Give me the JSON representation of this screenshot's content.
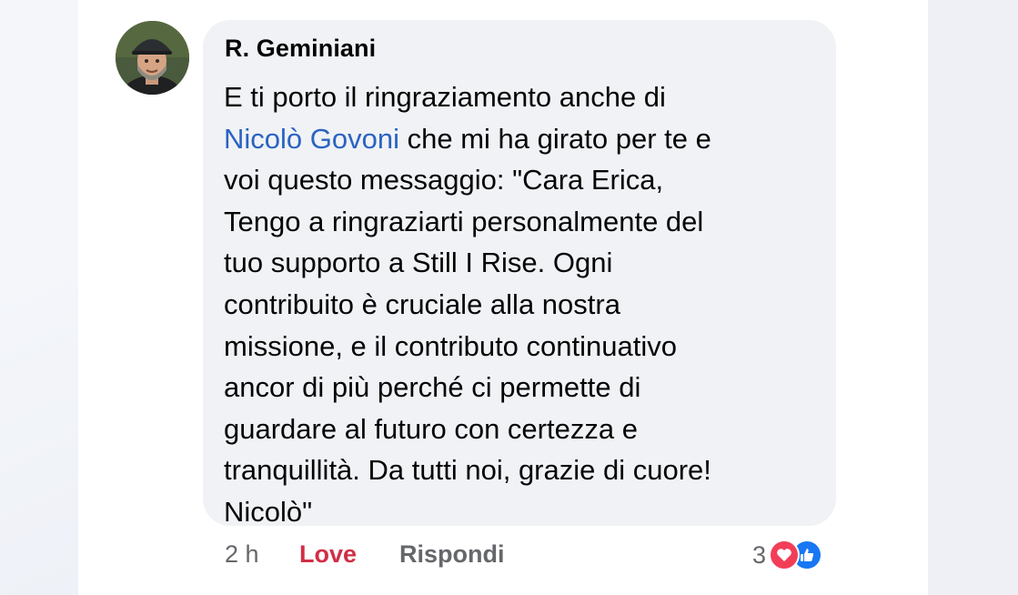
{
  "comment": {
    "author": "R. Geminiani",
    "avatar_icon": "profile-photo-man-with-cap",
    "message_lines": [
      {
        "text": "E ti porto il ringraziamento anche di"
      },
      {
        "mention": "Nicolò Govoni",
        "text": " che mi ha girato per te e"
      },
      {
        "text": "voi questo messaggio: \"Cara Erica,"
      },
      {
        "text": "Tengo a ringraziarti personalmente del"
      },
      {
        "text": "tuo supporto a Still I Rise. Ogni"
      },
      {
        "text": "contribuito è cruciale alla nostra"
      },
      {
        "text": "missione, e il contributo continuativo"
      },
      {
        "text": "ancor di più perché ci permette di"
      },
      {
        "text": "guardare al futuro con certezza e"
      },
      {
        "text": "tranquillità. Da tutti noi, grazie di cuore!"
      },
      {
        "text": "Nicolò\""
      }
    ]
  },
  "footer": {
    "time": "2 h",
    "love_label": "Love",
    "reply_label": "Rispondi",
    "reaction_count": "3",
    "reaction_icons": [
      "heart-icon",
      "thumbs-up-icon"
    ]
  },
  "colors": {
    "bubble": "#f0f2f5",
    "mention": "#2a63c2",
    "love": "#d12e46",
    "love_reaction": "#f33e58",
    "like_reaction": "#1877f2",
    "muted_text": "#65676b"
  }
}
